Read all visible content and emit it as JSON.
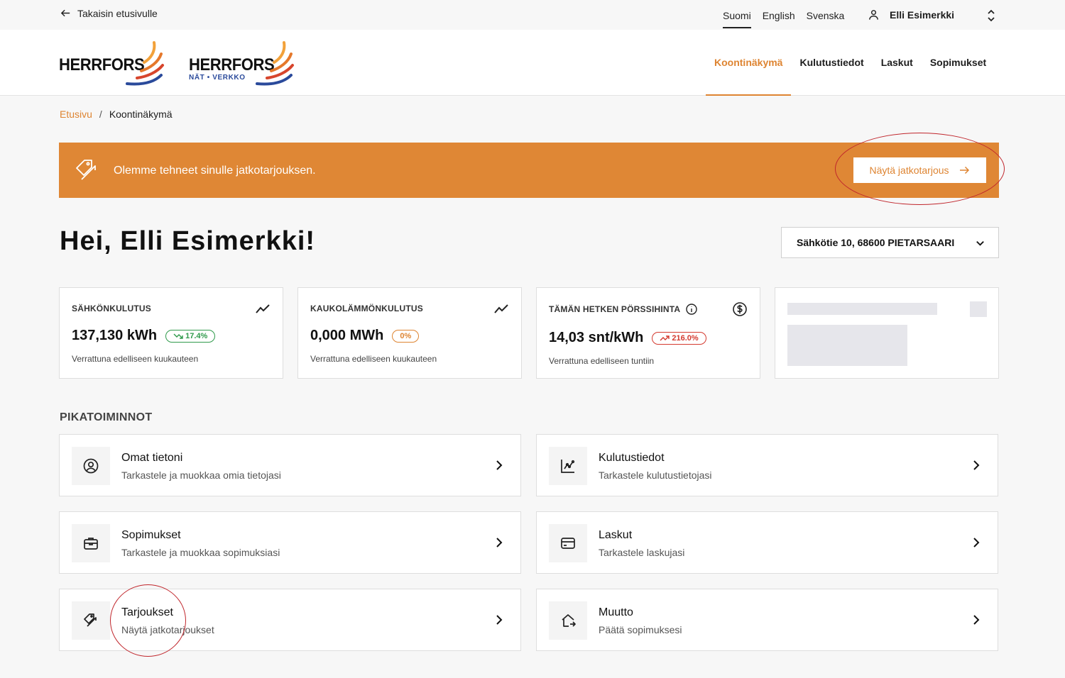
{
  "topbar": {
    "back_label": "Takaisin etusivulle",
    "languages": [
      "Suomi",
      "English",
      "Svenska"
    ],
    "active_language": "Suomi",
    "user_name": "Elli Esimerkki"
  },
  "logos": {
    "primary": "HERRFORS",
    "secondary": "HERRFORS",
    "secondary_sub": "NÄT • VERKKO"
  },
  "nav": {
    "items": [
      "Koontinäkymä",
      "Kulutustiedot",
      "Laskut",
      "Sopimukset"
    ],
    "active": "Koontinäkymä"
  },
  "breadcrumb": {
    "home": "Etusivu",
    "separator": "/",
    "current": "Koontinäkymä"
  },
  "banner": {
    "text": "Olemme tehneet sinulle jatkotarjouksen.",
    "button_label": "Näytä jatkotarjous",
    "icon": "tag-icon"
  },
  "greeting": "Hei, Elli Esimerkki!",
  "address_select": {
    "value": "Sähkötie 10, 68600 PIETARSAARI"
  },
  "stats": [
    {
      "label": "SÄHKÖNKULUTUS",
      "value": "137,130 kWh",
      "badge": "17.4%",
      "trend": "down",
      "badge_color": "#2f9a4b",
      "note": "Verrattuna edelliseen kuukauteen",
      "icon": "trend-line-icon"
    },
    {
      "label": "KAUKOLÄMMÖNKULUTUS",
      "value": "0,000 MWh",
      "badge": "0%",
      "trend": "flat",
      "badge_color": "#de8431",
      "note": "Verrattuna edelliseen kuukauteen",
      "icon": "trend-line-icon"
    },
    {
      "label": "TÄMÄN HETKEN PÖRSSIHINTA",
      "value": "14,03 snt/kWh",
      "badge": "216.0%",
      "trend": "up",
      "badge_color": "#d43a2f",
      "note": "Verrattuna edelliseen tuntiin",
      "icon": "dollar-circle-icon"
    }
  ],
  "quick_actions": {
    "title": "PIKATOIMINNOT",
    "items": [
      {
        "title": "Omat tietoni",
        "subtitle": "Tarkastele ja muokkaa omia tietojasi",
        "icon": "user-circle-icon"
      },
      {
        "title": "Kulutustiedot",
        "subtitle": "Tarkastele kulutustietojasi",
        "icon": "chart-icon"
      },
      {
        "title": "Sopimukset",
        "subtitle": "Tarkastele ja muokkaa sopimuksiasi",
        "icon": "briefcase-icon"
      },
      {
        "title": "Laskut",
        "subtitle": "Tarkastele laskujasi",
        "icon": "card-icon"
      },
      {
        "title": "Tarjoukset",
        "subtitle": "Näytä jatkotarjoukset",
        "icon": "tags-icon"
      },
      {
        "title": "Muutto",
        "subtitle": "Päätä sopimuksesi",
        "icon": "home-move-icon"
      }
    ]
  },
  "colors": {
    "accent": "#de8431",
    "banner": "#df8735",
    "highlight_ring": "#c0262c"
  }
}
